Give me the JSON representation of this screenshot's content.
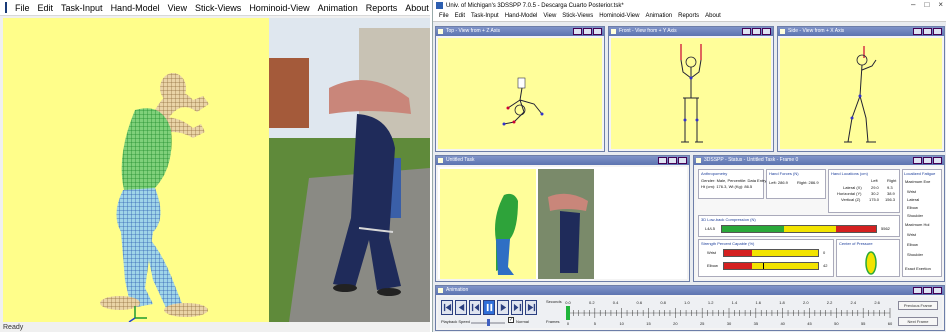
{
  "left_app": {
    "menu": [
      "File",
      "Edit",
      "Task-Input",
      "Hand-Model",
      "View",
      "Stick-Views",
      "Hominoid-View",
      "Animation",
      "Reports",
      "About"
    ],
    "status": "Ready",
    "icons": {
      "app": "app-logo-icon"
    },
    "colors": {
      "viewport_bg": "#fffe8a",
      "mesh_green": "#2ea33a",
      "mesh_blue": "#2f6fc4",
      "shoes": "#c6a15a"
    }
  },
  "right_app": {
    "title": "Univ. of Michigan's 3DSSPP 7.0.5 - Descarga Cuarto Posterior.tsk*",
    "window_controls": [
      "–",
      "□",
      "×"
    ],
    "menu": [
      "File",
      "Edit",
      "Task-Input",
      "Hand-Model",
      "View",
      "Stick-Views",
      "Hominoid-View",
      "Animation",
      "Reports",
      "About"
    ],
    "windows": {
      "top_view": "Top - View from + Z Axis",
      "front_view": "Front - View from + Y Axis",
      "side_view": "Side - View from + X Axis",
      "untitled_task": "Untitled Task",
      "report": "3DSSPP - Status - Untitled Task - Frame 0",
      "animation": "Animation"
    },
    "report": {
      "anthropometry_label": "Anthropometry",
      "anthropometry_line1": "Gender: Male, Percentile: Data Entry",
      "anthropometry_line2": "Ht (cm): 176.3, Wt (Kg): 86.5",
      "hand_forces_label": "Hand Forces (N)",
      "hand_forces_left": "Left: 286.9",
      "hand_forces_right": "Right: 286.9",
      "hand_locations_label": "Hand Locations (cm)",
      "hand_locations_cols": [
        "Left",
        "Right"
      ],
      "hand_locations_rows": [
        {
          "name": "Lateral (X)",
          "left": "29.0",
          "right": "9.3"
        },
        {
          "name": "Horizontal (Y)",
          "left": "30.2",
          "right": "38.9"
        },
        {
          "name": "Vertical (Z)",
          "left": "175.0",
          "right": "156.3"
        }
      ],
      "compression_label": "3D Low-back Compression (N)",
      "compression_row": "L4/L5",
      "compression_value": "5562",
      "strength_label": "Strength Percent Capable (%)",
      "strength_rows": [
        {
          "name": "Wrist",
          "value": "0"
        },
        {
          "name": "Elbow",
          "value": "42"
        }
      ],
      "cop_label": "Center of Pressure",
      "fatigue_label": "Localized Fatigue",
      "fatigue_rows": [
        "Maximum Exe",
        "Wrist",
        "Lateral",
        "Elbow",
        "Shoulder",
        "Maximum Hol",
        "Wrist",
        "Elbow",
        "Shoulder",
        "Exact Exertion"
      ]
    },
    "animation": {
      "seconds_label": "Seconds",
      "frames_label": "Frames",
      "second_ticks": [
        "0.0",
        "0.2",
        "0.4",
        "0.6",
        "0.8",
        "1.0",
        "1.2",
        "1.4",
        "1.6",
        "1.8",
        "2.0",
        "2.2",
        "2.4",
        "2.6"
      ],
      "frame_ticks": [
        "0",
        "5",
        "10",
        "15",
        "20",
        "25",
        "30",
        "35",
        "40",
        "45",
        "50",
        "55",
        "60"
      ],
      "playback_speed_label": "Playback Speed",
      "normal_label": "Normal",
      "previous_frame_btn": "Previous Frame",
      "next_frame_btn": "Next Frame",
      "icons": [
        "skip-start-icon",
        "step-back-icon",
        "rewind-icon",
        "pause-icon",
        "play-icon",
        "fast-forward-icon",
        "skip-end-icon"
      ],
      "colors": {
        "active": "#2f6fd8",
        "current_frame": "#1fb43a"
      }
    }
  }
}
